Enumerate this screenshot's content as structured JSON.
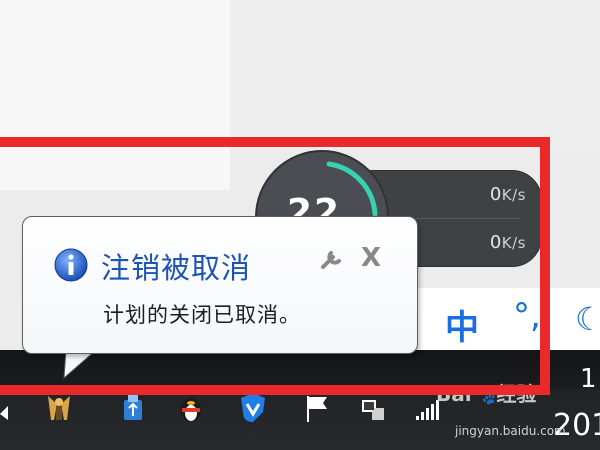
{
  "balloon": {
    "title": "注销被取消",
    "message": "计划的关闭已取消。",
    "icon": "info-icon",
    "settings_icon": "wrench-icon",
    "close_label": "X"
  },
  "speed_widget": {
    "circle_value": "22",
    "upload": {
      "value": "0",
      "unit": "K/s",
      "icon": "arrow-up-icon"
    },
    "download": {
      "value": "0",
      "unit": "K/s",
      "icon": "arrow-down-icon"
    },
    "accent_color": "#3ad0b0"
  },
  "ime": {
    "mode_char": "中",
    "punct_char": "°,",
    "moon_char": "☾"
  },
  "taskbar": {
    "clock_top": "1",
    "clock_bottom": "201",
    "tray_icons": [
      "show-hidden-icons-arrow",
      "wings-icon",
      "usb-drive-icon",
      "qq-penguin-icon",
      "shield-icon",
      "flag-icon",
      "network-icon",
      "signal-bars-icon"
    ]
  },
  "watermark": {
    "brand": "Bai",
    "brand_end": "经验",
    "url": "jingyan.baidu.com"
  },
  "colors": {
    "highlight": "#ea2a2a",
    "title_blue": "#1d54b4",
    "ime_blue": "#1a6fe0"
  }
}
